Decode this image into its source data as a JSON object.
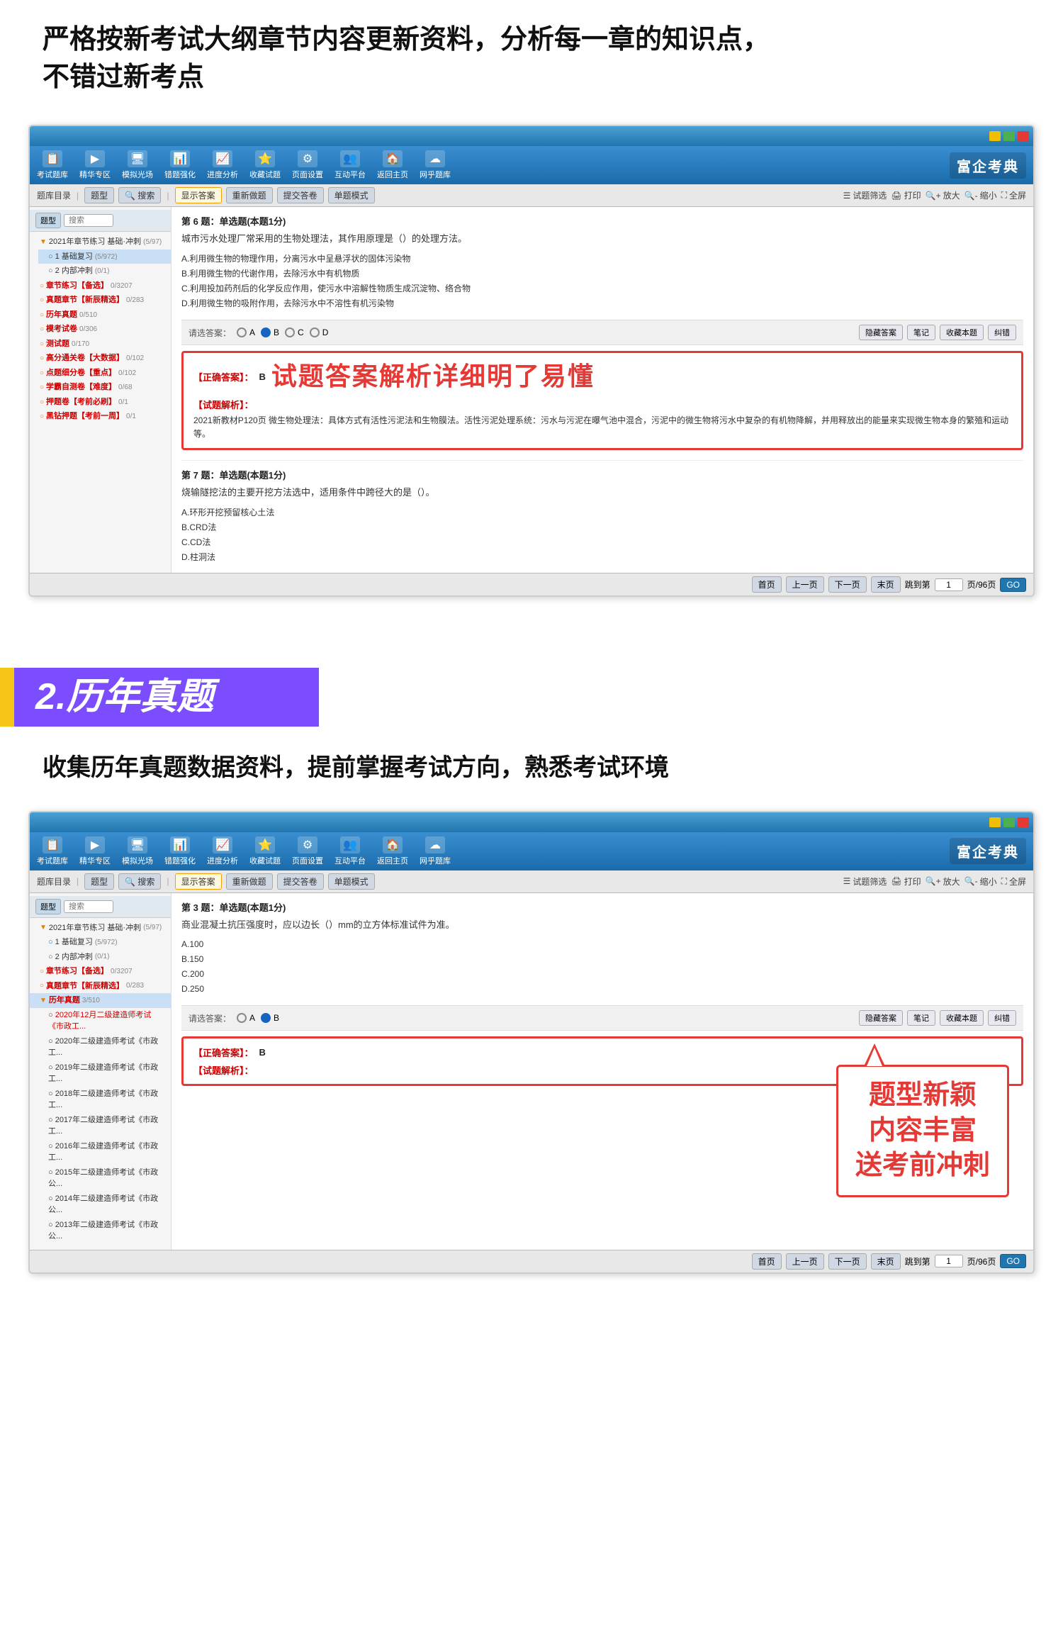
{
  "section1": {
    "heading_line1": "严格按新考试大纲章节内容更新资料，分析每一章的知识点，",
    "heading_line2": "不错过新考点"
  },
  "window1": {
    "toolbar_items": [
      {
        "label": "考试题库",
        "icon": "📋"
      },
      {
        "label": "精华专区",
        "icon": "▶"
      },
      {
        "label": "模拟光场",
        "icon": "🖥"
      },
      {
        "label": "错题强化",
        "icon": "📊"
      },
      {
        "label": "进度分析",
        "icon": "📈"
      },
      {
        "label": "收藏试题",
        "icon": "⭐"
      },
      {
        "label": "页面设置",
        "icon": "⚙"
      },
      {
        "label": "互动平台",
        "icon": "👥"
      },
      {
        "label": "返回主页",
        "icon": "🏠"
      },
      {
        "label": "网乎题库",
        "icon": "☁"
      }
    ],
    "logo": "富企考典",
    "sub_toolbar": {
      "buttons": [
        "显示答案",
        "重新做题",
        "提交答卷",
        "单题模式"
      ],
      "right_tools": [
        "试题筛选",
        "打印",
        "放大",
        "缩小",
        "全屏"
      ]
    },
    "sidebar": {
      "tab1": "题型",
      "search_placeholder": "搜索",
      "tree": [
        {
          "label": "2021年章节练习 基础·冲刺",
          "count": "(5/97)",
          "level": 0
        },
        {
          "label": "1 基础复习",
          "count": "(5/972)",
          "level": 1
        },
        {
          "label": "2 内部冲刺",
          "count": "(0/1)",
          "level": 1
        },
        {
          "label": "章节练习【备选】",
          "count": "0/3207",
          "level": 0,
          "color": "orange"
        },
        {
          "label": "真题章节【新辰精选】",
          "count": "0/283",
          "level": 0,
          "color": "orange"
        },
        {
          "label": "历年真题",
          "count": "0/510",
          "level": 0,
          "color": "orange"
        },
        {
          "label": "模考试卷",
          "count": "0/306",
          "level": 0,
          "color": "orange"
        },
        {
          "label": "测试题",
          "count": "0/170",
          "level": 0,
          "color": "orange"
        },
        {
          "label": "高分通关卷【大数据】",
          "count": "0/102",
          "level": 0,
          "color": "orange"
        },
        {
          "label": "点题细分卷【重点】",
          "count": "0/102",
          "level": 0,
          "color": "orange"
        },
        {
          "label": "学霸自测卷【难度】",
          "count": "0/68",
          "level": 0,
          "color": "orange"
        },
        {
          "label": "押题卷【考前必刷】",
          "count": "0/1",
          "level": 0,
          "color": "orange"
        },
        {
          "label": "黑钻押题【考前一周】",
          "count": "0/1",
          "level": 0,
          "color": "orange"
        }
      ]
    },
    "q6": {
      "title": "第 6 题：单选题(本题1分)",
      "stem": "城市污水处理厂常采用的生物处理法，其作用原理是（）的处理方法。",
      "options": [
        "A.利用微生物的物理作用，分离污水中呈悬浮状的固体污染物",
        "B.利用微生物的代谢作用，去除污水中有机物质",
        "C.利用投加药剂后的化学反应作用，使污水中溶解性物质生成沉淀物、络合物",
        "D.利用微生物的吸附作用，去除污水中不溶性有机污染物"
      ],
      "answer_label": "请选答案：",
      "choices": [
        "A",
        "B",
        "C",
        "D"
      ],
      "selected": "B",
      "right_btns": [
        "隐藏答案",
        "笔记",
        "收藏本题",
        "纠错"
      ],
      "correct_answer_label": "【正确答案】：",
      "correct_answer_value": "B",
      "big_text": "试题答案解析详细明了易懂",
      "analysis_label": "【试题解析】：",
      "analysis_content": "2021新教材P120页\n微生物处理法：具体方式有活性污泥法和生物膜法。活性污泥处理系统：污水与污泥在曝气池中混合，污泥中的微生物将污水中复杂的有机物降解，并用释放出的能量来实现微生物本身的繁殖和运动等。"
    },
    "q7": {
      "title": "第 7 题：单选题(本题1分)",
      "stem": "烧输隧挖法的主要开挖方法选中，适用条件中跨径大的是（）。",
      "options": [
        "A.环形开挖预留核心土法",
        "B.CRD法",
        "C.CD法",
        "D.柱洞法"
      ]
    },
    "bottom_nav": {
      "btns": [
        "首页",
        "上一页",
        "下一页",
        "末页"
      ],
      "page_label": "跳到第",
      "page_value": "1",
      "total_label": "页/96页",
      "go_label": "GO"
    }
  },
  "section2": {
    "banner_text": "2.历年真题"
  },
  "section3": {
    "heading": "收集历年真题数据资料，提前掌握考试方向，熟悉考试环境"
  },
  "window2": {
    "logo": "富企考典",
    "sub_toolbar": {
      "buttons": [
        "显示答案",
        "重新做题",
        "提交答卷",
        "单题模式"
      ],
      "right_tools": [
        "试题筛选",
        "打印",
        "放大",
        "缩小",
        "全屏"
      ]
    },
    "sidebar": {
      "tab1": "题型",
      "search_placeholder": "搜索",
      "tree": [
        {
          "label": "2021年章节练习 基础·冲刺",
          "count": "(5/97)",
          "level": 0
        },
        {
          "label": "1 基础复习",
          "count": "(5/972)",
          "level": 1
        },
        {
          "label": "2 内部冲刺",
          "count": "(0/1)",
          "level": 1
        },
        {
          "label": "章节练习【备选】",
          "count": "0/3207",
          "level": 0
        },
        {
          "label": "真题章节【新辰精选】",
          "count": "0/283",
          "level": 0
        },
        {
          "label": "历年真题",
          "count": "3/510",
          "level": 0,
          "selected": true
        },
        {
          "label": "2020年12月二级建造师考试《市政工",
          "count": "",
          "level": 1,
          "color": "red"
        },
        {
          "label": "2020年二级建造师考试《市政工",
          "count": "",
          "level": 1
        },
        {
          "label": "2019年二级建造师考试《市政工",
          "count": "",
          "level": 1
        },
        {
          "label": "2018年二级建造师考试《市政工",
          "count": "",
          "level": 1
        },
        {
          "label": "2017年二级建造师考试《市政工",
          "count": "",
          "level": 1
        },
        {
          "label": "2016年二级建造师考试《市政工",
          "count": "",
          "level": 1
        },
        {
          "label": "2015年二级建造师考试《市政公",
          "count": "",
          "level": 1
        },
        {
          "label": "2014年二级建造师考试《市政公",
          "count": "",
          "level": 1
        },
        {
          "label": "2013年二级建造师考试《市政公",
          "count": "",
          "level": 1
        }
      ]
    },
    "q3": {
      "title": "第 3 题：单选题(本题1分)",
      "stem": "商业混凝土抗压强度时，应以边长（）mm的立方体标准试件为准。",
      "options": [
        "A.100",
        "B.150",
        "C.200",
        "D.250"
      ],
      "answer_label": "请选答案：",
      "choices": [
        "A",
        "B"
      ],
      "selected": "B",
      "right_btns": [
        "隐藏答案",
        "笔记",
        "收藏本题",
        "纠错"
      ],
      "correct_answer_label": "【正确答案】：",
      "correct_answer_value": "B",
      "analysis_label": "【试题解析】：",
      "callout_line1": "题型新颖",
      "callout_line2": "内容丰富",
      "callout_line3": "送考前冲刺"
    },
    "bottom_nav": {
      "btns": [
        "首页",
        "上一页",
        "下一页",
        "末页"
      ],
      "page_label": "跳到第",
      "page_value": "1",
      "total_label": "页/96页",
      "go_label": "GO"
    }
  }
}
